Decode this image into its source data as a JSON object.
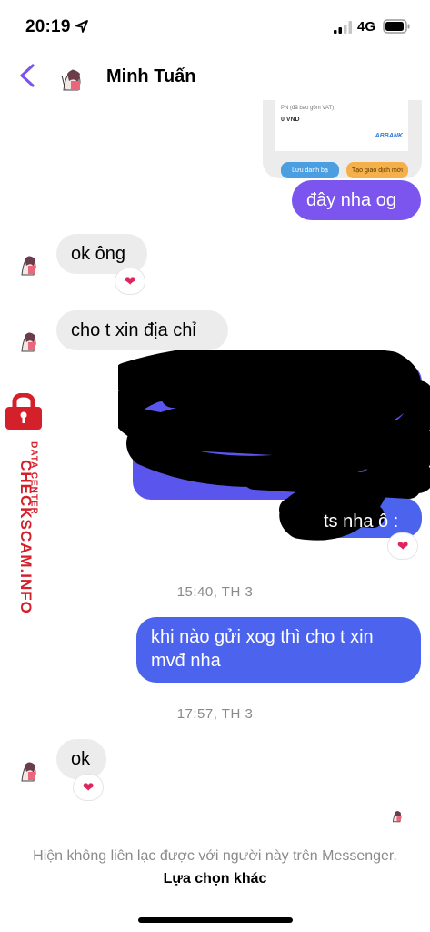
{
  "status_bar": {
    "time": "20:19",
    "network": "4G"
  },
  "header": {
    "contact_name": "Minh Tuấn"
  },
  "shared_card": {
    "line1": "PN (đã bao gồm VAT)",
    "line2": "0 VND",
    "bank": "ABBANK",
    "button1": "Lưu danh bạ",
    "button2": "Tạo giao dịch mới"
  },
  "messages": [
    {
      "text": "đây nha og"
    },
    {
      "text": "ok ông",
      "reaction": "❤"
    },
    {
      "text": "cho t xin địa chỉ"
    },
    {
      "text": "ts nha ô :",
      "reaction": "❤"
    },
    {
      "text": "khi nào gửi xog thì cho t xin mvđ nha"
    },
    {
      "text": "ok",
      "reaction": "❤"
    }
  ],
  "timestamps": [
    "15:40, TH 3",
    "17:57, TH 3"
  ],
  "footer": {
    "notice": "Hiện không liên lạc được với người này trên Messenger.",
    "link": "Lựa chọn khác"
  },
  "watermark": {
    "main": "CHECKSCAM.INFO",
    "sub": "DATA CENTER"
  },
  "colors": {
    "accent": "#7b55ed",
    "outgoing_blue": "#4c63ee",
    "incoming": "#ececec",
    "watermark_red": "#d4202b"
  }
}
